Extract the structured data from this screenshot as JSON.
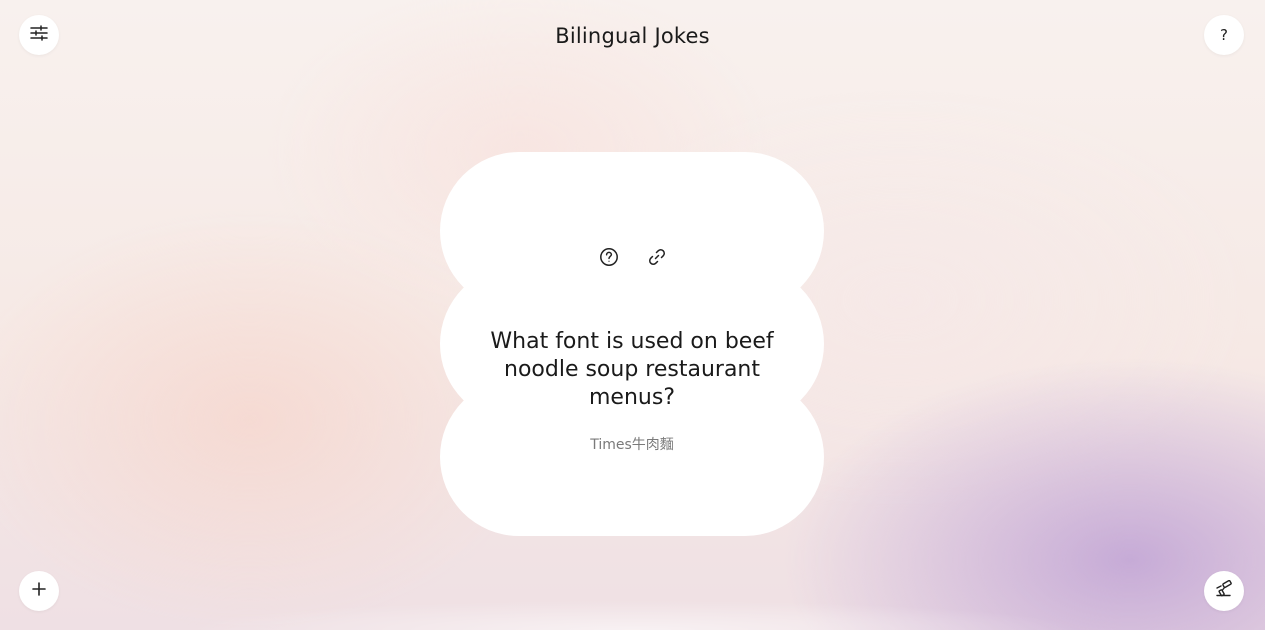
{
  "header": {
    "title": "Bilingual Jokes",
    "settings_icon": "sliders-icon",
    "help_label": "?"
  },
  "card": {
    "icons": [
      "question-circle-icon",
      "link-icon"
    ],
    "question": "What font is used on beef noodle soup restaurant menus?",
    "answer": "Times牛肉麵"
  },
  "footer": {
    "add_icon": "plus-icon",
    "theme_icon": "paint-roller-icon"
  },
  "colors": {
    "background_peach": "#f6e9e5",
    "background_lavender": "#c4a8d6",
    "card": "#ffffff",
    "text": "#1a1a1a",
    "muted_text": "#7a7a7a"
  }
}
